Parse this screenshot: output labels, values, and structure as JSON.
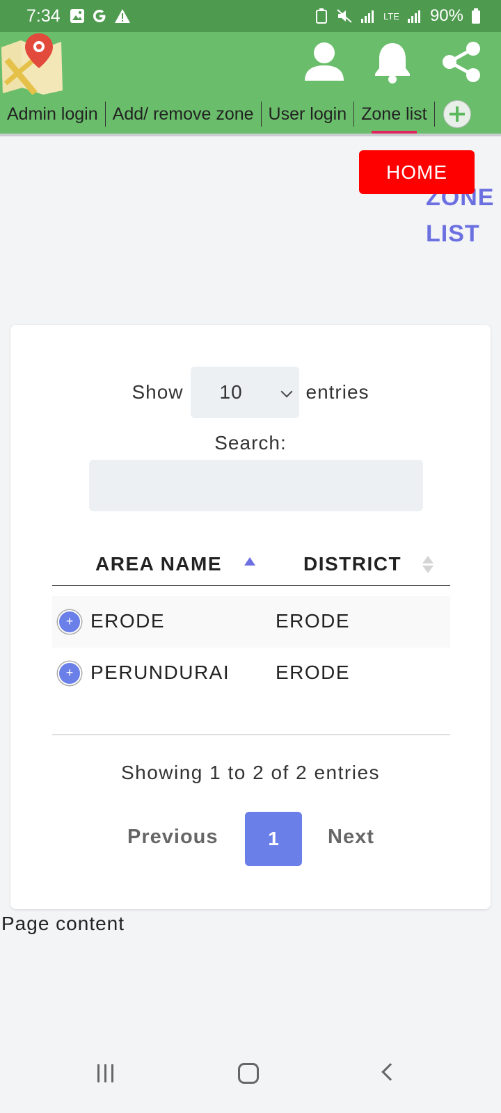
{
  "status_bar": {
    "time": "7:34",
    "battery": "90%",
    "network": "LTE"
  },
  "header": {
    "icons": [
      "map-logo-icon",
      "user-icon",
      "bell-icon",
      "share-icon"
    ]
  },
  "tabs": [
    {
      "label": "Admin login",
      "active": false
    },
    {
      "label": "Add/ remove zone",
      "active": false
    },
    {
      "label": "User login",
      "active": false
    },
    {
      "label": "Zone list",
      "active": true
    }
  ],
  "home_button": "HOME",
  "page_title_line1": "ZONE",
  "page_title_line2": "LIST",
  "table_controls": {
    "show_label": "Show",
    "entries_value": "10",
    "entries_label": "entries",
    "search_label": "Search:",
    "search_value": ""
  },
  "table": {
    "columns": [
      "AREA NAME",
      "DISTRICT"
    ],
    "rows": [
      {
        "area": "ERODE",
        "district": "ERODE"
      },
      {
        "area": "PERUNDURAI",
        "district": "ERODE"
      }
    ]
  },
  "info": "Showing 1 to 2 of 2 entries",
  "pagination": {
    "previous": "Previous",
    "current_page": "1",
    "next": "Next"
  },
  "page_content": "Page content",
  "colors": {
    "status_bar": "#4e9a4f",
    "header": "#6abe6b",
    "home_button": "#ff0000",
    "accent": "#6b7fe8",
    "tab_indicator": "#e0245e"
  }
}
